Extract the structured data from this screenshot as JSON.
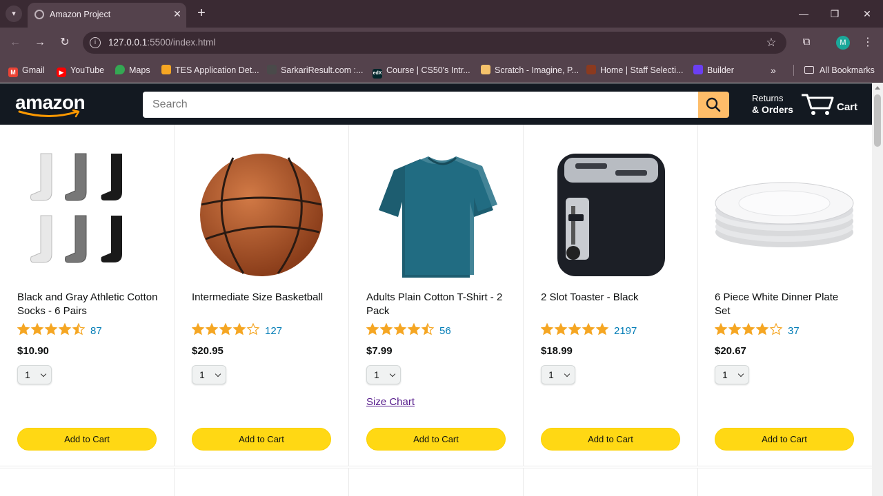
{
  "browser": {
    "tab_title": "Amazon Project",
    "url_host": "127.0.0.1",
    "url_path": ":5500/index.html",
    "bookmarks": [
      {
        "label": "Gmail",
        "icon": "gmail-icon",
        "color": "#ea4335"
      },
      {
        "label": "YouTube",
        "icon": "youtube-icon",
        "color": "#ff0000"
      },
      {
        "label": "Maps",
        "icon": "maps-icon",
        "color": "#34a853"
      },
      {
        "label": "TES Application Det...",
        "icon": "tes-icon",
        "color": "#f5a623"
      },
      {
        "label": "SarkariResult.com :...",
        "icon": "sarkari-icon",
        "color": "#4a4a4a"
      },
      {
        "label": "Course | CS50's Intr...",
        "icon": "edx-icon",
        "color": "#02262b"
      },
      {
        "label": "Scratch - Imagine, P...",
        "icon": "scratch-icon",
        "color": "#f5c26b"
      },
      {
        "label": "Home | Staff Selecti...",
        "icon": "ssc-icon",
        "color": "#8b3a1f"
      },
      {
        "label": "Builder",
        "icon": "builder-icon",
        "color": "#6b3ff2"
      }
    ],
    "all_bookmarks": "All Bookmarks",
    "profile_initial": "M"
  },
  "header": {
    "logo": "amazon",
    "search_placeholder": "Search",
    "returns_line1": "Returns",
    "returns_line2": "& Orders",
    "cart_label": "Cart"
  },
  "products": [
    {
      "name": "Black and Gray Athletic Cotton Socks - 6 Pairs",
      "stars": 4.5,
      "rating_count": "87",
      "price": "$10.90",
      "quantity": "1",
      "add_to_cart": "Add to Cart",
      "image": "socks"
    },
    {
      "name": "Intermediate Size Basketball",
      "stars": 4.0,
      "rating_count": "127",
      "price": "$20.95",
      "quantity": "1",
      "add_to_cart": "Add to Cart",
      "image": "basketball"
    },
    {
      "name": "Adults Plain Cotton T-Shirt - 2 Pack",
      "stars": 4.5,
      "rating_count": "56",
      "price": "$7.99",
      "quantity": "1",
      "add_to_cart": "Add to Cart",
      "size_chart": "Size Chart",
      "image": "tshirt"
    },
    {
      "name": "2 Slot Toaster - Black",
      "stars": 5.0,
      "rating_count": "2197",
      "price": "$18.99",
      "quantity": "1",
      "add_to_cart": "Add to Cart",
      "image": "toaster"
    },
    {
      "name": "6 Piece White Dinner Plate Set",
      "stars": 4.0,
      "rating_count": "37",
      "price": "$20.67",
      "quantity": "1",
      "add_to_cart": "Add to Cart",
      "image": "plates"
    }
  ],
  "colors": {
    "header_bg": "#131921",
    "search_button": "#febd69",
    "add_to_cart": "#ffd814",
    "star": "#f5a623",
    "rating_link": "#017cb6"
  }
}
